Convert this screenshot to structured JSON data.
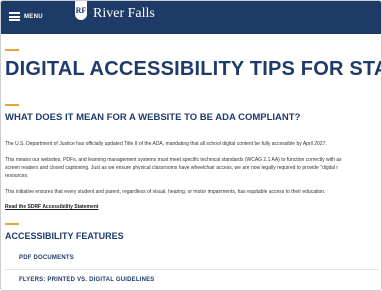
{
  "header": {
    "menu_label": "MENU",
    "logo_mark": "RF",
    "site_name": "River Falls"
  },
  "main": {
    "title": "DIGITAL ACCESSIBILITY TIPS FOR STA",
    "subtitle": "WHAT DOES IT MEAN FOR A WEBSITE TO BE ADA COMPLIANT?",
    "paragraphs": [
      "The U.S. Department of Justice has officially updated Title II of the ADA, mandating that all school digital content be fully accessible by April 2027.",
      "This means our websites, PDFs, and learning management systems must meet specific technical standards (WCAG 2.1 AA) to function correctly with as",
      "screen readers and closed captioning. Just as we ensure physical classrooms have wheelchair access, we are now legally required to provide \"digital r",
      "resources.",
      "This initiative ensures that every student and parent, regardless of visual, hearing, or motor impairments, has equitable access to their education."
    ],
    "statement_link": "Read the SDRF Accessibility Statement"
  },
  "features": {
    "heading": "ACCESSIBILITY FEATURES",
    "items": [
      "PDF DOCUMENTS",
      "FLYERS: PRINTED VS. DIGITAL GUIDELINES"
    ]
  },
  "colors": {
    "header_bg": "#1e3a66",
    "heading_text": "#1f3b6a",
    "accent": "#e6a23c"
  }
}
